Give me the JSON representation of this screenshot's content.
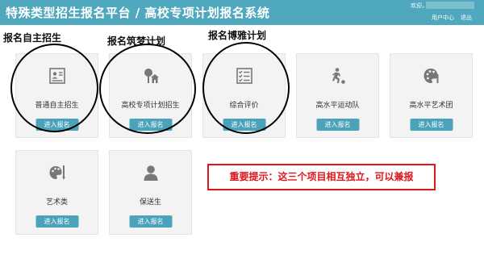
{
  "header": {
    "title": "特殊类型招生报名平台 / 高校专项计划报名系统",
    "welcome": "欢迎，",
    "user_center": "用户中心",
    "logout": "退出"
  },
  "cards": [
    {
      "label": "普通自主招生",
      "button": "进入报名",
      "icon": "id-card-icon"
    },
    {
      "label": "高校专项计划招生",
      "button": "进入报名",
      "icon": "tree-house-icon"
    },
    {
      "label": "综合评价",
      "button": "进入报名",
      "icon": "checklist-icon"
    },
    {
      "label": "高水平运动队",
      "button": "进入报名",
      "icon": "athlete-icon"
    },
    {
      "label": "高水平艺术团",
      "button": "进入报名",
      "icon": "palette-icon"
    },
    {
      "label": "艺术类",
      "button": "进入报名",
      "icon": "palette-brush-icon"
    },
    {
      "label": "保送生",
      "button": "进入报名",
      "icon": "user-icon"
    }
  ],
  "annotations": {
    "a1": "报名自主招生",
    "a2": "报名筑梦计划",
    "a3": "报名博雅计划"
  },
  "notice": "重要提示：这三个项目相互独立，可以兼报"
}
